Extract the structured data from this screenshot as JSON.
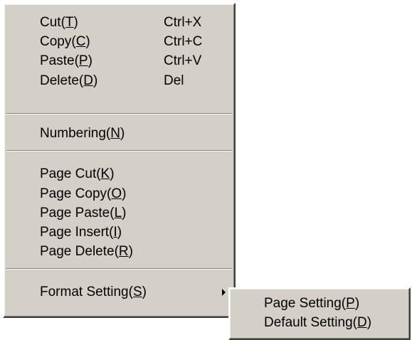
{
  "main_menu": {
    "items": [
      {
        "label_pre": "Cut(",
        "mnemonic": "T",
        "label_post": ")",
        "shortcut": "Ctrl+X"
      },
      {
        "label_pre": "Copy(",
        "mnemonic": "C",
        "label_post": ")",
        "shortcut": "Ctrl+C"
      },
      {
        "label_pre": "Paste(",
        "mnemonic": "P",
        "label_post": ")",
        "shortcut": "Ctrl+V"
      },
      {
        "label_pre": "Delete(",
        "mnemonic": "D",
        "label_post": ")",
        "shortcut": "Del"
      },
      {
        "label_pre": "Numbering(",
        "mnemonic": "N",
        "label_post": ")"
      },
      {
        "label_pre": "Page Cut(",
        "mnemonic": "K",
        "label_post": ")"
      },
      {
        "label_pre": "Page Copy(",
        "mnemonic": "O",
        "label_post": ")"
      },
      {
        "label_pre": "Page Paste(",
        "mnemonic": "L",
        "label_post": ")"
      },
      {
        "label_pre": "Page Insert(",
        "mnemonic": "I",
        "label_post": ")"
      },
      {
        "label_pre": "Page Delete(",
        "mnemonic": "R",
        "label_post": ")"
      },
      {
        "label_pre": "Format Setting(",
        "mnemonic": "S",
        "label_post": ")",
        "submenu_icon": "submenu-arrow-icon"
      }
    ]
  },
  "sub_menu": {
    "items": [
      {
        "label_pre": "Page Setting(",
        "mnemonic": "P",
        "label_post": ")"
      },
      {
        "label_pre": "Default Setting(",
        "mnemonic": "D",
        "label_post": ")"
      }
    ]
  },
  "colors": {
    "menu_background": "#d4d0c8",
    "text": "#000000",
    "separator_dark": "#808080",
    "separator_light": "#ffffff"
  }
}
